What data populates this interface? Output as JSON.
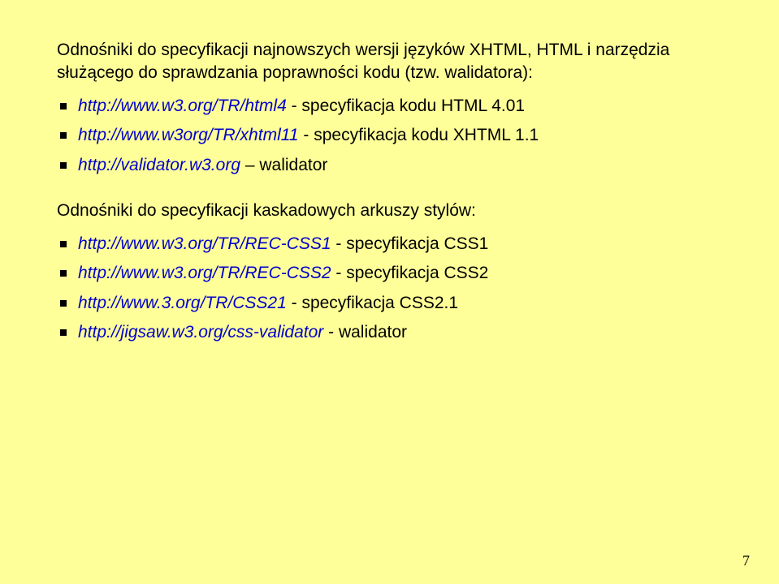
{
  "section1": {
    "intro": "Odnośniki do specyfikacji najnowszych wersji języków XHTML, HTML i narzędzia służącego do sprawdzania poprawności kodu (tzw. walidatora):",
    "items": [
      {
        "url": "http://www.w3.org/TR/html4",
        "desc": " - specyfikacja kodu HTML 4.01"
      },
      {
        "url": "http://www.w3org/TR/xhtml11",
        "desc": " - specyfikacja kodu XHTML 1.1"
      },
      {
        "url": "http://validator.w3.org",
        "desc": " – walidator"
      }
    ]
  },
  "section2": {
    "intro": "Odnośniki do specyfikacji kaskadowych arkuszy stylów:",
    "items": [
      {
        "url": "http://www.w3.org/TR/REC-CSS1",
        "desc": " - specyfikacja CSS1"
      },
      {
        "url": "http://www.w3.org/TR/REC-CSS2",
        "desc": " - specyfikacja CSS2"
      },
      {
        "url": "http://www.3.org/TR/CSS21",
        "desc": " - specyfikacja CSS2.1"
      },
      {
        "url": "http://jigsaw.w3.org/css-validator",
        "desc": " - walidator"
      }
    ]
  },
  "pageNumber": "7"
}
